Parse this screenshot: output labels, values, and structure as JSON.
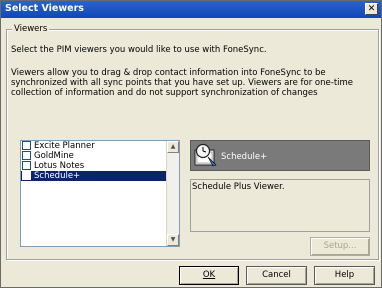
{
  "window": {
    "title": "Select Viewers"
  },
  "group": {
    "label": "Viewers"
  },
  "intro": "Select the PIM viewers you would like to use with FoneSync.",
  "description": "Viewers allow you to drag & drop contact information into FoneSync to be synchronized with all sync points that you have set up. Viewers are for one-time collection of information and do not support synchronization of changes",
  "viewers": [
    {
      "label": "Excite Planner",
      "checked": false
    },
    {
      "label": "GoldMine",
      "checked": false
    },
    {
      "label": "Lotus Notes",
      "checked": false
    },
    {
      "label": "Schedule+",
      "checked": false,
      "selected": true
    }
  ],
  "selected_viewer": {
    "name": "Schedule+",
    "description": "Schedule Plus Viewer.",
    "icon": "schedule-plus-icon"
  },
  "buttons": {
    "setup": "Setup...",
    "ok": "OK",
    "cancel": "Cancel",
    "help": "Help"
  },
  "colors": {
    "title_bar": "#1046b8",
    "selection": "#0a246a",
    "viewer_header": "#7a7a7a"
  }
}
